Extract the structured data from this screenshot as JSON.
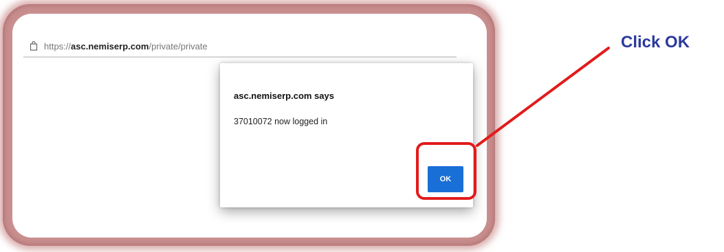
{
  "browser": {
    "url_prefix": "https://",
    "url_domain": "asc.nemiserp.com",
    "url_path": "/private/private"
  },
  "dialog": {
    "title": "asc.nemiserp.com says",
    "message": "37010072 now logged in",
    "ok_label": "OK"
  },
  "annotation": {
    "label": "Click OK",
    "label_color": "#2b3a9c",
    "highlight_color": "#e21b1b"
  },
  "colors": {
    "ok_button": "#1a6fd6",
    "frame_glow": "#c98f8f"
  }
}
